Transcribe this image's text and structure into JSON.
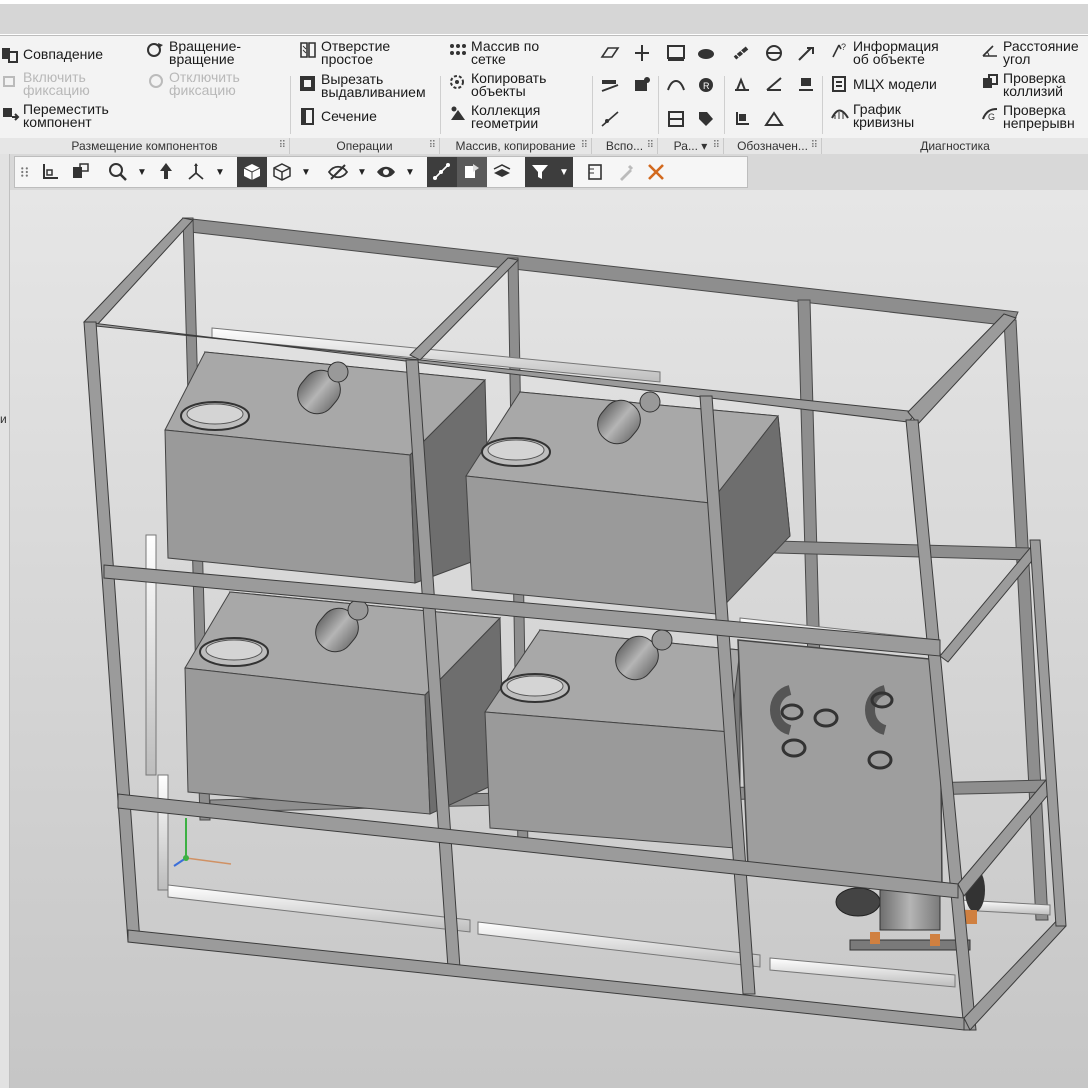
{
  "ribbon": {
    "placement": {
      "coincidence": "Совпадение",
      "rotation": [
        "Вращение-",
        "вращение"
      ],
      "enable_fix": [
        "Включить",
        "фиксацию"
      ],
      "disable_fix": [
        "Отключить",
        "фиксацию"
      ],
      "move": [
        "Переместить",
        "компонент"
      ]
    },
    "operations": {
      "hole": [
        "Отверстие",
        "простое"
      ],
      "cut_extrude": [
        "Вырезать",
        "выдавливанием"
      ],
      "section": "Сечение"
    },
    "arrays": {
      "grid_array": [
        "Массив по",
        "сетке"
      ],
      "copy_objects": [
        "Копировать",
        "объекты"
      ],
      "geometry_collection": [
        "Коллекция",
        "геометрии"
      ]
    },
    "diagnostics": {
      "object_info": [
        "Информация",
        "об объекте"
      ],
      "mass_props": "МЦХ модели",
      "curvature": [
        "График",
        "кривизны"
      ],
      "distance": [
        "Расстояние",
        "угол"
      ],
      "collisions": [
        "Проверка",
        "коллизий"
      ],
      "continuity": [
        "Проверка",
        "непрерывн"
      ]
    },
    "groups": {
      "placement": "Размещение компонентов",
      "operations": "Операции",
      "arrays": "Массив, копирование",
      "aux": "Вспо...",
      "ra": "Ра...",
      "notation": "Обозначен...",
      "diagnostics": "Диагностика"
    }
  },
  "leftstrip": {
    "label": "и"
  },
  "icons": {
    "ribbon": [
      "coincidence-icon",
      "rotation-icon",
      "enable-fix-icon",
      "disable-fix-icon",
      "move-component-icon",
      "hole-icon",
      "cut-extrude-icon",
      "section-icon",
      "grid-array-icon",
      "copy-objects-icon",
      "geometry-collection-icon",
      "object-info-icon",
      "mass-props-icon",
      "curvature-icon",
      "distance-angle-icon",
      "collision-check-icon",
      "continuity-check-icon"
    ],
    "view_toolbar": [
      "grip-icon",
      "orientation-icon",
      "model-tree-icon",
      "zoom-icon",
      "pan-icon",
      "view-orient-icon",
      "shaded-icon",
      "wireframe-icon",
      "hide-icon",
      "display-mode-icon",
      "snap-icon",
      "filter-objects-icon",
      "layers-icon",
      "filter-icon",
      "measure-icon",
      "pipette-icon",
      "close-icon"
    ]
  },
  "colors": {
    "ribbon_bg": "#f3f3f3",
    "viewport_top": "#e6e6e6",
    "viewport_bottom": "#c6c6c6",
    "frame_steel": "#8c8c8c",
    "tank": "#9a9a9a",
    "pipe": "#f2f2f2",
    "active_button": "#3d3d3d",
    "close_x": "#d2691e",
    "axis_green": "#3cb043",
    "axis_blue": "#3b6fd9"
  }
}
